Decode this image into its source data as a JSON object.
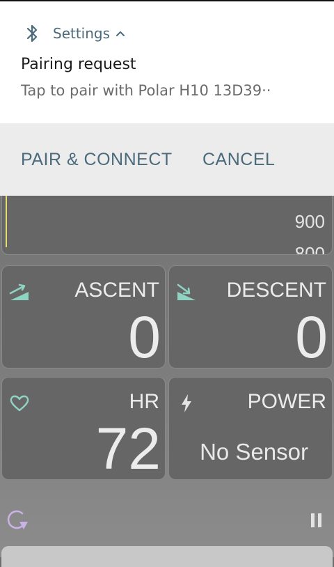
{
  "notification": {
    "app_name": "Settings",
    "title": "Pairing request",
    "text": "Tap to pair with Polar H10 13D39··",
    "actions": {
      "pair_label": "PAIR & CONNECT",
      "cancel_label": "CANCEL"
    },
    "icons": {
      "app": "bluetooth-icon",
      "expand": "chevron-up-icon"
    }
  },
  "graph": {
    "value": "900",
    "value_partial": "800"
  },
  "tiles": {
    "ascent": {
      "label": "ASCENT",
      "value": "0",
      "icon": "ascent-icon"
    },
    "descent": {
      "label": "DESCENT",
      "value": "0",
      "icon": "descent-icon"
    },
    "hr": {
      "label": "HR",
      "value": "72",
      "icon": "heart-icon"
    },
    "power": {
      "label": "POWER",
      "value": "No Sensor",
      "icon": "lightning-icon"
    }
  },
  "bottom": {
    "left_icon": "refresh-icon",
    "right_icon": "pause-icon"
  },
  "colors": {
    "accent": "#4b6b7b",
    "icon_teal": "#8fd3c2",
    "icon_lavender": "#c9b2e6",
    "graph_line": "#e6dc6e"
  }
}
